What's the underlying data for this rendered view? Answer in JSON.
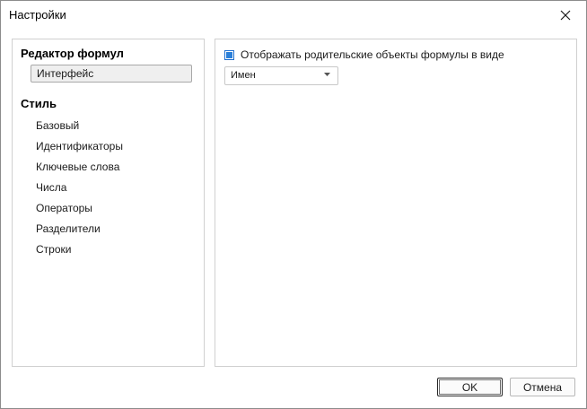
{
  "window": {
    "title": "Настройки"
  },
  "sidebar": {
    "sections": [
      {
        "heading": "Редактор формул",
        "items": [
          "Интерфейс"
        ]
      },
      {
        "heading": "Стиль",
        "items": [
          "Базовый",
          "Идентификаторы",
          "Ключевые слова",
          "Числа",
          "Операторы",
          "Разделители",
          "Строки"
        ]
      }
    ],
    "selected": "Интерфейс"
  },
  "settings": {
    "checkbox_label": "Отображать родительские объекты формулы в виде",
    "checkbox_checked": true,
    "select_value": "Имен"
  },
  "buttons": {
    "ok": "OK",
    "cancel": "Отмена"
  },
  "colors": {
    "accent": "#2a7fd9"
  },
  "icons": {
    "close": "close-icon",
    "dropdown": "chevron-down-icon"
  }
}
